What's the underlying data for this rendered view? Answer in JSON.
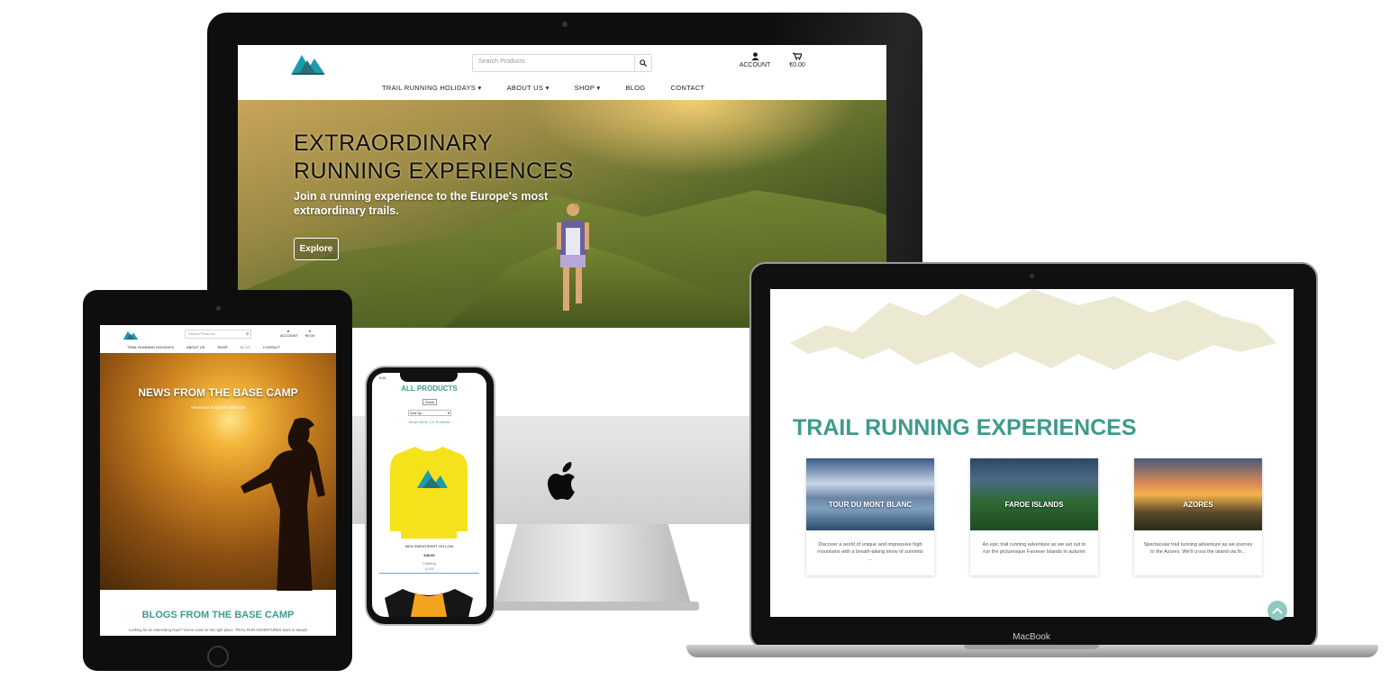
{
  "brand": {
    "accent": "#3e9b8c",
    "logo_colors": [
      "#1a9bb0",
      "#2a6f7a"
    ]
  },
  "desktop": {
    "search_placeholder": "Search Products",
    "account_label": "ACCOUNT",
    "cart_total": "€0.00",
    "menu": [
      "TRAIL RUNNING HOLIDAYS",
      "ABOUT US",
      "SHOP",
      "BLOG",
      "CONTACT"
    ],
    "hero_title_line1": "EXTRAORDINARY",
    "hero_title_line2": "RUNNING EXPERIENCES",
    "hero_subtitle": "Join a running experience to the Europe's most extraordinary trails.",
    "hero_button": "Explore"
  },
  "tablet": {
    "search_placeholder": "Search Products",
    "account_label": "ACCOUNT",
    "cart_total": "€0.00",
    "menu": [
      "TRAIL RUNNING HOLIDAYS",
      "ABOUT US",
      "SHOP",
      "BLOG",
      "CONTACT"
    ],
    "hero_title": "NEWS FROM THE BASE CAMP",
    "hero_subtitle": "Adventure Enquiries Welcome",
    "section_title": "BLOGS FROM THE BASE CAMP",
    "section_text": "Looking for an interesting read? You've come to the right place. TRAIL RUN ADVENTURES team is always"
  },
  "phone": {
    "status_time": "9:41",
    "page_title": "ALL PRODUCTS",
    "filter_button": "Show",
    "sort_select": "Sort by...",
    "breadcrumb": "Shop Home | 14 Products",
    "product_name": "MEN SWEATSHIRT YELLOW",
    "product_price": "€40.00",
    "product_category": "Clothing",
    "product_rating": "4.5/5"
  },
  "laptop": {
    "section_title": "TRAIL RUNNING EXPERIENCES",
    "cards": [
      {
        "title": "TOUR DU MONT BLANC",
        "text": "Discover a world of unique and impressive high mountains with a breath-taking show of summits ..."
      },
      {
        "title": "FAROE ISLANDS",
        "text": "An epic trail running adventure as we set out to run the picturesque Faroese Islands in autumn"
      },
      {
        "title": "AZORES",
        "text": "Spectacular trail running adventure as we journey to the Azores. We'll cross the island via th..."
      }
    ],
    "brand_label": "MacBook"
  },
  "icons": [
    "search-icon",
    "user-icon",
    "cart-icon",
    "caret-down-icon",
    "apple-logo-icon",
    "chevron-up-icon"
  ]
}
